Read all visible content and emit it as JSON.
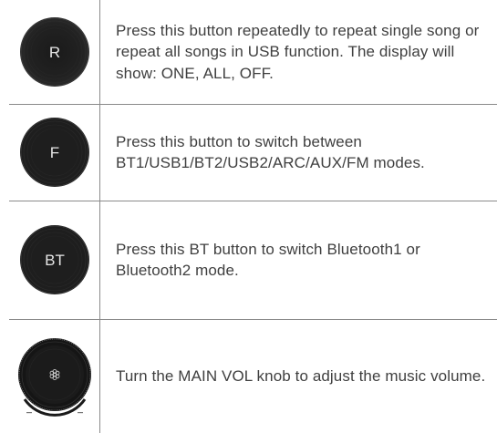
{
  "rows": [
    {
      "button_letter": "R",
      "icon": "repeat-button-icon",
      "description": "Press this button repeatedly to repeat single song or repeat all songs in  USB function. The display will show: ONE, ALL, OFF."
    },
    {
      "button_letter": "F",
      "icon": "function-button-icon",
      "description": "Press this button to switch between BT1/USB1/BT2/USB2/ARC/AUX/FM modes."
    },
    {
      "button_letter": "BT",
      "icon": "bluetooth-button-icon",
      "description": "Press this BT button to switch Bluetooth1 or Bluetooth2 mode."
    },
    {
      "button_letter": "",
      "icon": "main-volume-knob-icon",
      "description": "Turn the MAIN VOL knob to adjust the music volume."
    }
  ],
  "colors": {
    "button_fill": "#1c1c1c",
    "button_text": "#e6e6e6",
    "rule_lines": "#8a8a8a",
    "text": "#3f3f3f"
  }
}
